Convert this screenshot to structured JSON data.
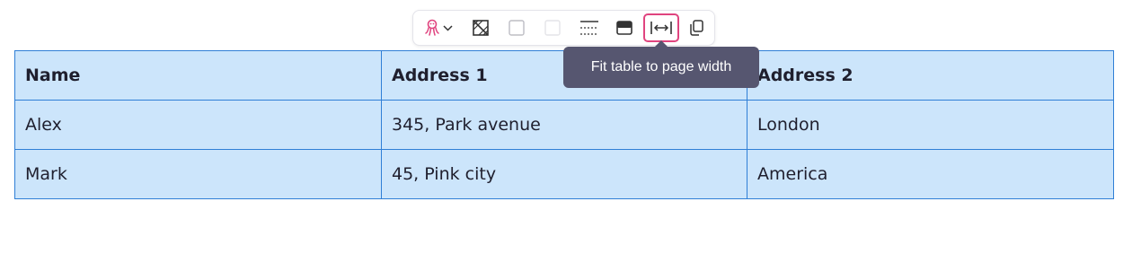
{
  "table": {
    "headers": [
      "Name",
      "Address 1",
      "Address 2"
    ],
    "rows": [
      [
        "Alex",
        "345, Park avenue",
        "London"
      ],
      [
        "Mark",
        "45, Pink city",
        "America"
      ]
    ],
    "colors": {
      "cell_background": "#cce5fb",
      "border": "#2f7fd6"
    }
  },
  "toolbar": {
    "buttons": [
      {
        "icon": "octopus-icon",
        "has_dropdown": true,
        "color": "#e0447f"
      },
      {
        "icon": "no-fill-cell-icon"
      },
      {
        "icon": "cell-border-icon"
      },
      {
        "icon": "cell-border-light-icon"
      },
      {
        "icon": "row-lines-icon"
      },
      {
        "icon": "header-row-icon"
      },
      {
        "icon": "fit-width-icon",
        "active": true
      },
      {
        "icon": "copy-icon"
      }
    ],
    "active_color": "#e0447f"
  },
  "tooltip": {
    "text": "Fit table to page width",
    "background": "#565670"
  }
}
